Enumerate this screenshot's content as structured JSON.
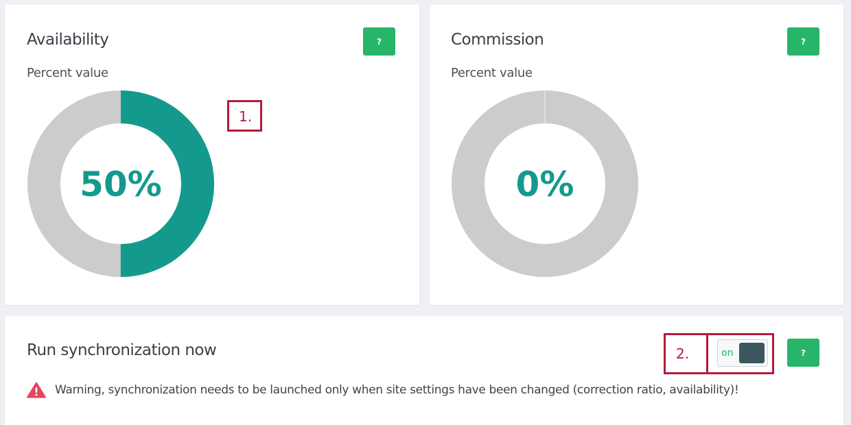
{
  "availability": {
    "title": "Availability",
    "subtitle": "Percent value",
    "percent": 50,
    "percent_label": "50%",
    "help_label": "?"
  },
  "commission": {
    "title": "Commission",
    "subtitle": "Percent value",
    "percent": 0,
    "percent_label": "0%",
    "help_label": "?"
  },
  "sync": {
    "title": "Run synchronization now",
    "warning": "Warning, synchronization needs to be launched only when site settings have been changed (correction ratio, availability)!",
    "toggle_label": "on",
    "toggle_state": true,
    "help_label": "?"
  },
  "annotations": {
    "first": "1.",
    "second": "2."
  },
  "colors": {
    "accent": "#149a8d",
    "track": "#cccccc",
    "help_button": "#27b56a",
    "annotation": "#b5193c",
    "warning": "#e8445d",
    "toggle_knob": "#3d5760"
  },
  "icons": {
    "warning": "warning-triangle-icon"
  }
}
